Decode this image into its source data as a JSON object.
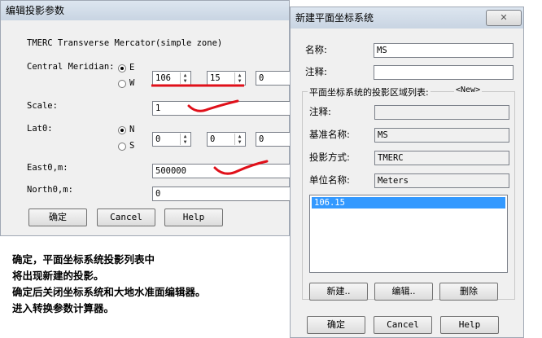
{
  "left_dialog": {
    "title": "编辑投影参数",
    "header": "TMERC  Transverse Mercator(simple zone)",
    "central_meridian": {
      "label": "Central Meridian:",
      "e": "E",
      "w": "W",
      "deg": "106",
      "min": "15",
      "sec": "0"
    },
    "scale": {
      "label": "Scale:",
      "value": "1"
    },
    "lat0": {
      "label": "Lat0:",
      "n": "N",
      "s": "S",
      "deg": "0",
      "min": "0",
      "sec": "0"
    },
    "east0": {
      "label": "East0,m:",
      "value": "500000"
    },
    "north0": {
      "label": "North0,m:",
      "value": "0"
    },
    "buttons": {
      "ok": "确定",
      "cancel": "Cancel",
      "help": "Help"
    }
  },
  "right_dialog": {
    "title": "新建平面坐标系统",
    "name": {
      "label": "名称:",
      "value": "MS"
    },
    "comment": {
      "label": "注释:",
      "value": ""
    },
    "group": {
      "legend": "平面坐标系统的投影区域列表:",
      "new_tag": "<New>",
      "comment_label": "注释:",
      "comment_value": "",
      "datum_label": "基准名称:",
      "datum_value": "MS",
      "projection_label": "投影方式:",
      "projection_value": "TMERC",
      "unit_label": "单位名称:",
      "unit_value": "Meters",
      "list_items": [
        "106.15"
      ]
    },
    "list_buttons": {
      "new": "新建..",
      "edit": "编辑..",
      "delete": "删除"
    },
    "buttons": {
      "ok": "确定",
      "cancel": "Cancel",
      "help": "Help"
    }
  },
  "instructions": [
    "确定，平面坐标系统投影列表中",
    "将出现新建的投影。",
    "确定后关闭坐标系统和大地水准面编辑器。",
    "进入转换参数计算器。"
  ],
  "colors": {
    "annotation_red": "#e0101a",
    "selection_blue": "#3399ff"
  }
}
